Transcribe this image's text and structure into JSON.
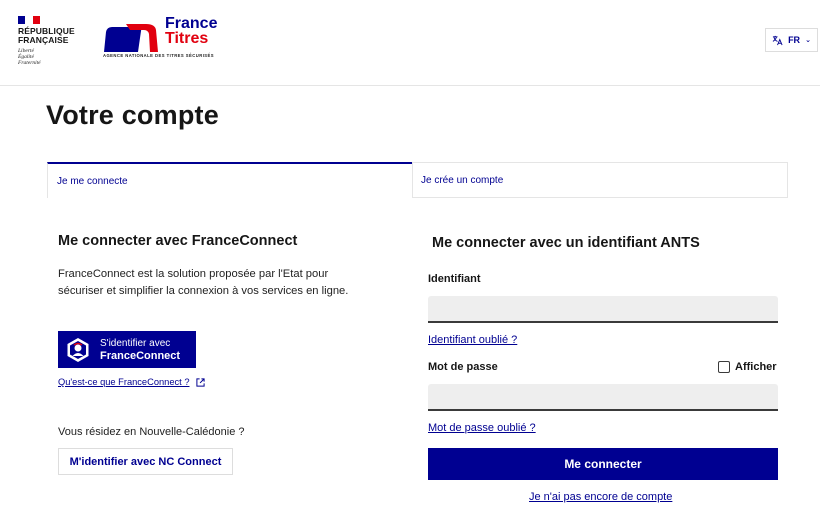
{
  "header": {
    "republic_line1": "RÉPUBLIQUE",
    "republic_line2": "FRANÇAISE",
    "motto_line1": "Liberté",
    "motto_line2": "Égalité",
    "motto_line3": "Fraternité",
    "brand_word1": "France",
    "brand_word2": "Titres",
    "brand_subtitle": "AGENCE NATIONALE DES TITRES SÉCURISÉS",
    "language": "FR"
  },
  "page": {
    "title": "Votre compte"
  },
  "tabs": [
    {
      "label": "Je me connecte",
      "selected": true
    },
    {
      "label": "Je crée un compte",
      "selected": false
    }
  ],
  "franceconnect": {
    "title": "Me connecter avec FranceConnect",
    "description": "FranceConnect est la solution proposée par l'Etat pour sécuriser et simplifier la connexion à vos services en ligne.",
    "button_line1": "S'identifier avec",
    "button_line2": "FranceConnect",
    "info_link": "Qu'est-ce que FranceConnect ?"
  },
  "nc": {
    "question": "Vous résidez en Nouvelle-Calédonie ?",
    "button": "M'identifier avec NC Connect"
  },
  "ants": {
    "title": "Me connecter avec un identifiant ANTS",
    "id_label": "Identifiant",
    "id_value": "",
    "forgot_id": "Identifiant oublié ?",
    "password_label": "Mot de passe",
    "show_password": "Afficher",
    "password_value": "",
    "forgot_password": "Mot de passe oublié ?",
    "submit": "Me connecter",
    "no_account": "Je n'ai pas encore de compte"
  },
  "colors": {
    "primary_blue": "#000091",
    "marianne_red": "#e1000f"
  },
  "icons": {
    "translate": "translate-icon",
    "chevron": "chevron-down-icon",
    "external": "external-link-icon",
    "franceconnect": "franceconnect-logo-icon"
  }
}
